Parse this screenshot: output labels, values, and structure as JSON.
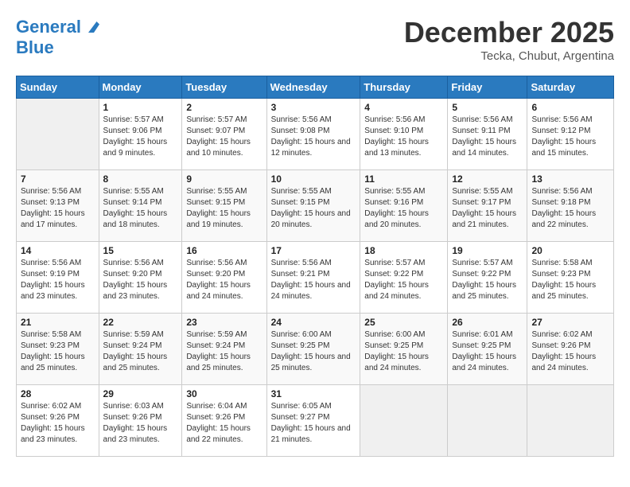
{
  "header": {
    "logo_line1": "General",
    "logo_line2": "Blue",
    "month": "December 2025",
    "location": "Tecka, Chubut, Argentina"
  },
  "weekdays": [
    "Sunday",
    "Monday",
    "Tuesday",
    "Wednesday",
    "Thursday",
    "Friday",
    "Saturday"
  ],
  "weeks": [
    [
      {
        "day": "",
        "sunrise": "",
        "sunset": "",
        "daylight": ""
      },
      {
        "day": "1",
        "sunrise": "Sunrise: 5:57 AM",
        "sunset": "Sunset: 9:06 PM",
        "daylight": "Daylight: 15 hours and 9 minutes."
      },
      {
        "day": "2",
        "sunrise": "Sunrise: 5:57 AM",
        "sunset": "Sunset: 9:07 PM",
        "daylight": "Daylight: 15 hours and 10 minutes."
      },
      {
        "day": "3",
        "sunrise": "Sunrise: 5:56 AM",
        "sunset": "Sunset: 9:08 PM",
        "daylight": "Daylight: 15 hours and 12 minutes."
      },
      {
        "day": "4",
        "sunrise": "Sunrise: 5:56 AM",
        "sunset": "Sunset: 9:10 PM",
        "daylight": "Daylight: 15 hours and 13 minutes."
      },
      {
        "day": "5",
        "sunrise": "Sunrise: 5:56 AM",
        "sunset": "Sunset: 9:11 PM",
        "daylight": "Daylight: 15 hours and 14 minutes."
      },
      {
        "day": "6",
        "sunrise": "Sunrise: 5:56 AM",
        "sunset": "Sunset: 9:12 PM",
        "daylight": "Daylight: 15 hours and 15 minutes."
      }
    ],
    [
      {
        "day": "7",
        "sunrise": "Sunrise: 5:56 AM",
        "sunset": "Sunset: 9:13 PM",
        "daylight": "Daylight: 15 hours and 17 minutes."
      },
      {
        "day": "8",
        "sunrise": "Sunrise: 5:55 AM",
        "sunset": "Sunset: 9:14 PM",
        "daylight": "Daylight: 15 hours and 18 minutes."
      },
      {
        "day": "9",
        "sunrise": "Sunrise: 5:55 AM",
        "sunset": "Sunset: 9:15 PM",
        "daylight": "Daylight: 15 hours and 19 minutes."
      },
      {
        "day": "10",
        "sunrise": "Sunrise: 5:55 AM",
        "sunset": "Sunset: 9:15 PM",
        "daylight": "Daylight: 15 hours and 20 minutes."
      },
      {
        "day": "11",
        "sunrise": "Sunrise: 5:55 AM",
        "sunset": "Sunset: 9:16 PM",
        "daylight": "Daylight: 15 hours and 20 minutes."
      },
      {
        "day": "12",
        "sunrise": "Sunrise: 5:55 AM",
        "sunset": "Sunset: 9:17 PM",
        "daylight": "Daylight: 15 hours and 21 minutes."
      },
      {
        "day": "13",
        "sunrise": "Sunrise: 5:56 AM",
        "sunset": "Sunset: 9:18 PM",
        "daylight": "Daylight: 15 hours and 22 minutes."
      }
    ],
    [
      {
        "day": "14",
        "sunrise": "Sunrise: 5:56 AM",
        "sunset": "Sunset: 9:19 PM",
        "daylight": "Daylight: 15 hours and 23 minutes."
      },
      {
        "day": "15",
        "sunrise": "Sunrise: 5:56 AM",
        "sunset": "Sunset: 9:20 PM",
        "daylight": "Daylight: 15 hours and 23 minutes."
      },
      {
        "day": "16",
        "sunrise": "Sunrise: 5:56 AM",
        "sunset": "Sunset: 9:20 PM",
        "daylight": "Daylight: 15 hours and 24 minutes."
      },
      {
        "day": "17",
        "sunrise": "Sunrise: 5:56 AM",
        "sunset": "Sunset: 9:21 PM",
        "daylight": "Daylight: 15 hours and 24 minutes."
      },
      {
        "day": "18",
        "sunrise": "Sunrise: 5:57 AM",
        "sunset": "Sunset: 9:22 PM",
        "daylight": "Daylight: 15 hours and 24 minutes."
      },
      {
        "day": "19",
        "sunrise": "Sunrise: 5:57 AM",
        "sunset": "Sunset: 9:22 PM",
        "daylight": "Daylight: 15 hours and 25 minutes."
      },
      {
        "day": "20",
        "sunrise": "Sunrise: 5:58 AM",
        "sunset": "Sunset: 9:23 PM",
        "daylight": "Daylight: 15 hours and 25 minutes."
      }
    ],
    [
      {
        "day": "21",
        "sunrise": "Sunrise: 5:58 AM",
        "sunset": "Sunset: 9:23 PM",
        "daylight": "Daylight: 15 hours and 25 minutes."
      },
      {
        "day": "22",
        "sunrise": "Sunrise: 5:59 AM",
        "sunset": "Sunset: 9:24 PM",
        "daylight": "Daylight: 15 hours and 25 minutes."
      },
      {
        "day": "23",
        "sunrise": "Sunrise: 5:59 AM",
        "sunset": "Sunset: 9:24 PM",
        "daylight": "Daylight: 15 hours and 25 minutes."
      },
      {
        "day": "24",
        "sunrise": "Sunrise: 6:00 AM",
        "sunset": "Sunset: 9:25 PM",
        "daylight": "Daylight: 15 hours and 25 minutes."
      },
      {
        "day": "25",
        "sunrise": "Sunrise: 6:00 AM",
        "sunset": "Sunset: 9:25 PM",
        "daylight": "Daylight: 15 hours and 24 minutes."
      },
      {
        "day": "26",
        "sunrise": "Sunrise: 6:01 AM",
        "sunset": "Sunset: 9:25 PM",
        "daylight": "Daylight: 15 hours and 24 minutes."
      },
      {
        "day": "27",
        "sunrise": "Sunrise: 6:02 AM",
        "sunset": "Sunset: 9:26 PM",
        "daylight": "Daylight: 15 hours and 24 minutes."
      }
    ],
    [
      {
        "day": "28",
        "sunrise": "Sunrise: 6:02 AM",
        "sunset": "Sunset: 9:26 PM",
        "daylight": "Daylight: 15 hours and 23 minutes."
      },
      {
        "day": "29",
        "sunrise": "Sunrise: 6:03 AM",
        "sunset": "Sunset: 9:26 PM",
        "daylight": "Daylight: 15 hours and 23 minutes."
      },
      {
        "day": "30",
        "sunrise": "Sunrise: 6:04 AM",
        "sunset": "Sunset: 9:26 PM",
        "daylight": "Daylight: 15 hours and 22 minutes."
      },
      {
        "day": "31",
        "sunrise": "Sunrise: 6:05 AM",
        "sunset": "Sunset: 9:27 PM",
        "daylight": "Daylight: 15 hours and 21 minutes."
      },
      {
        "day": "",
        "sunrise": "",
        "sunset": "",
        "daylight": ""
      },
      {
        "day": "",
        "sunrise": "",
        "sunset": "",
        "daylight": ""
      },
      {
        "day": "",
        "sunrise": "",
        "sunset": "",
        "daylight": ""
      }
    ]
  ]
}
